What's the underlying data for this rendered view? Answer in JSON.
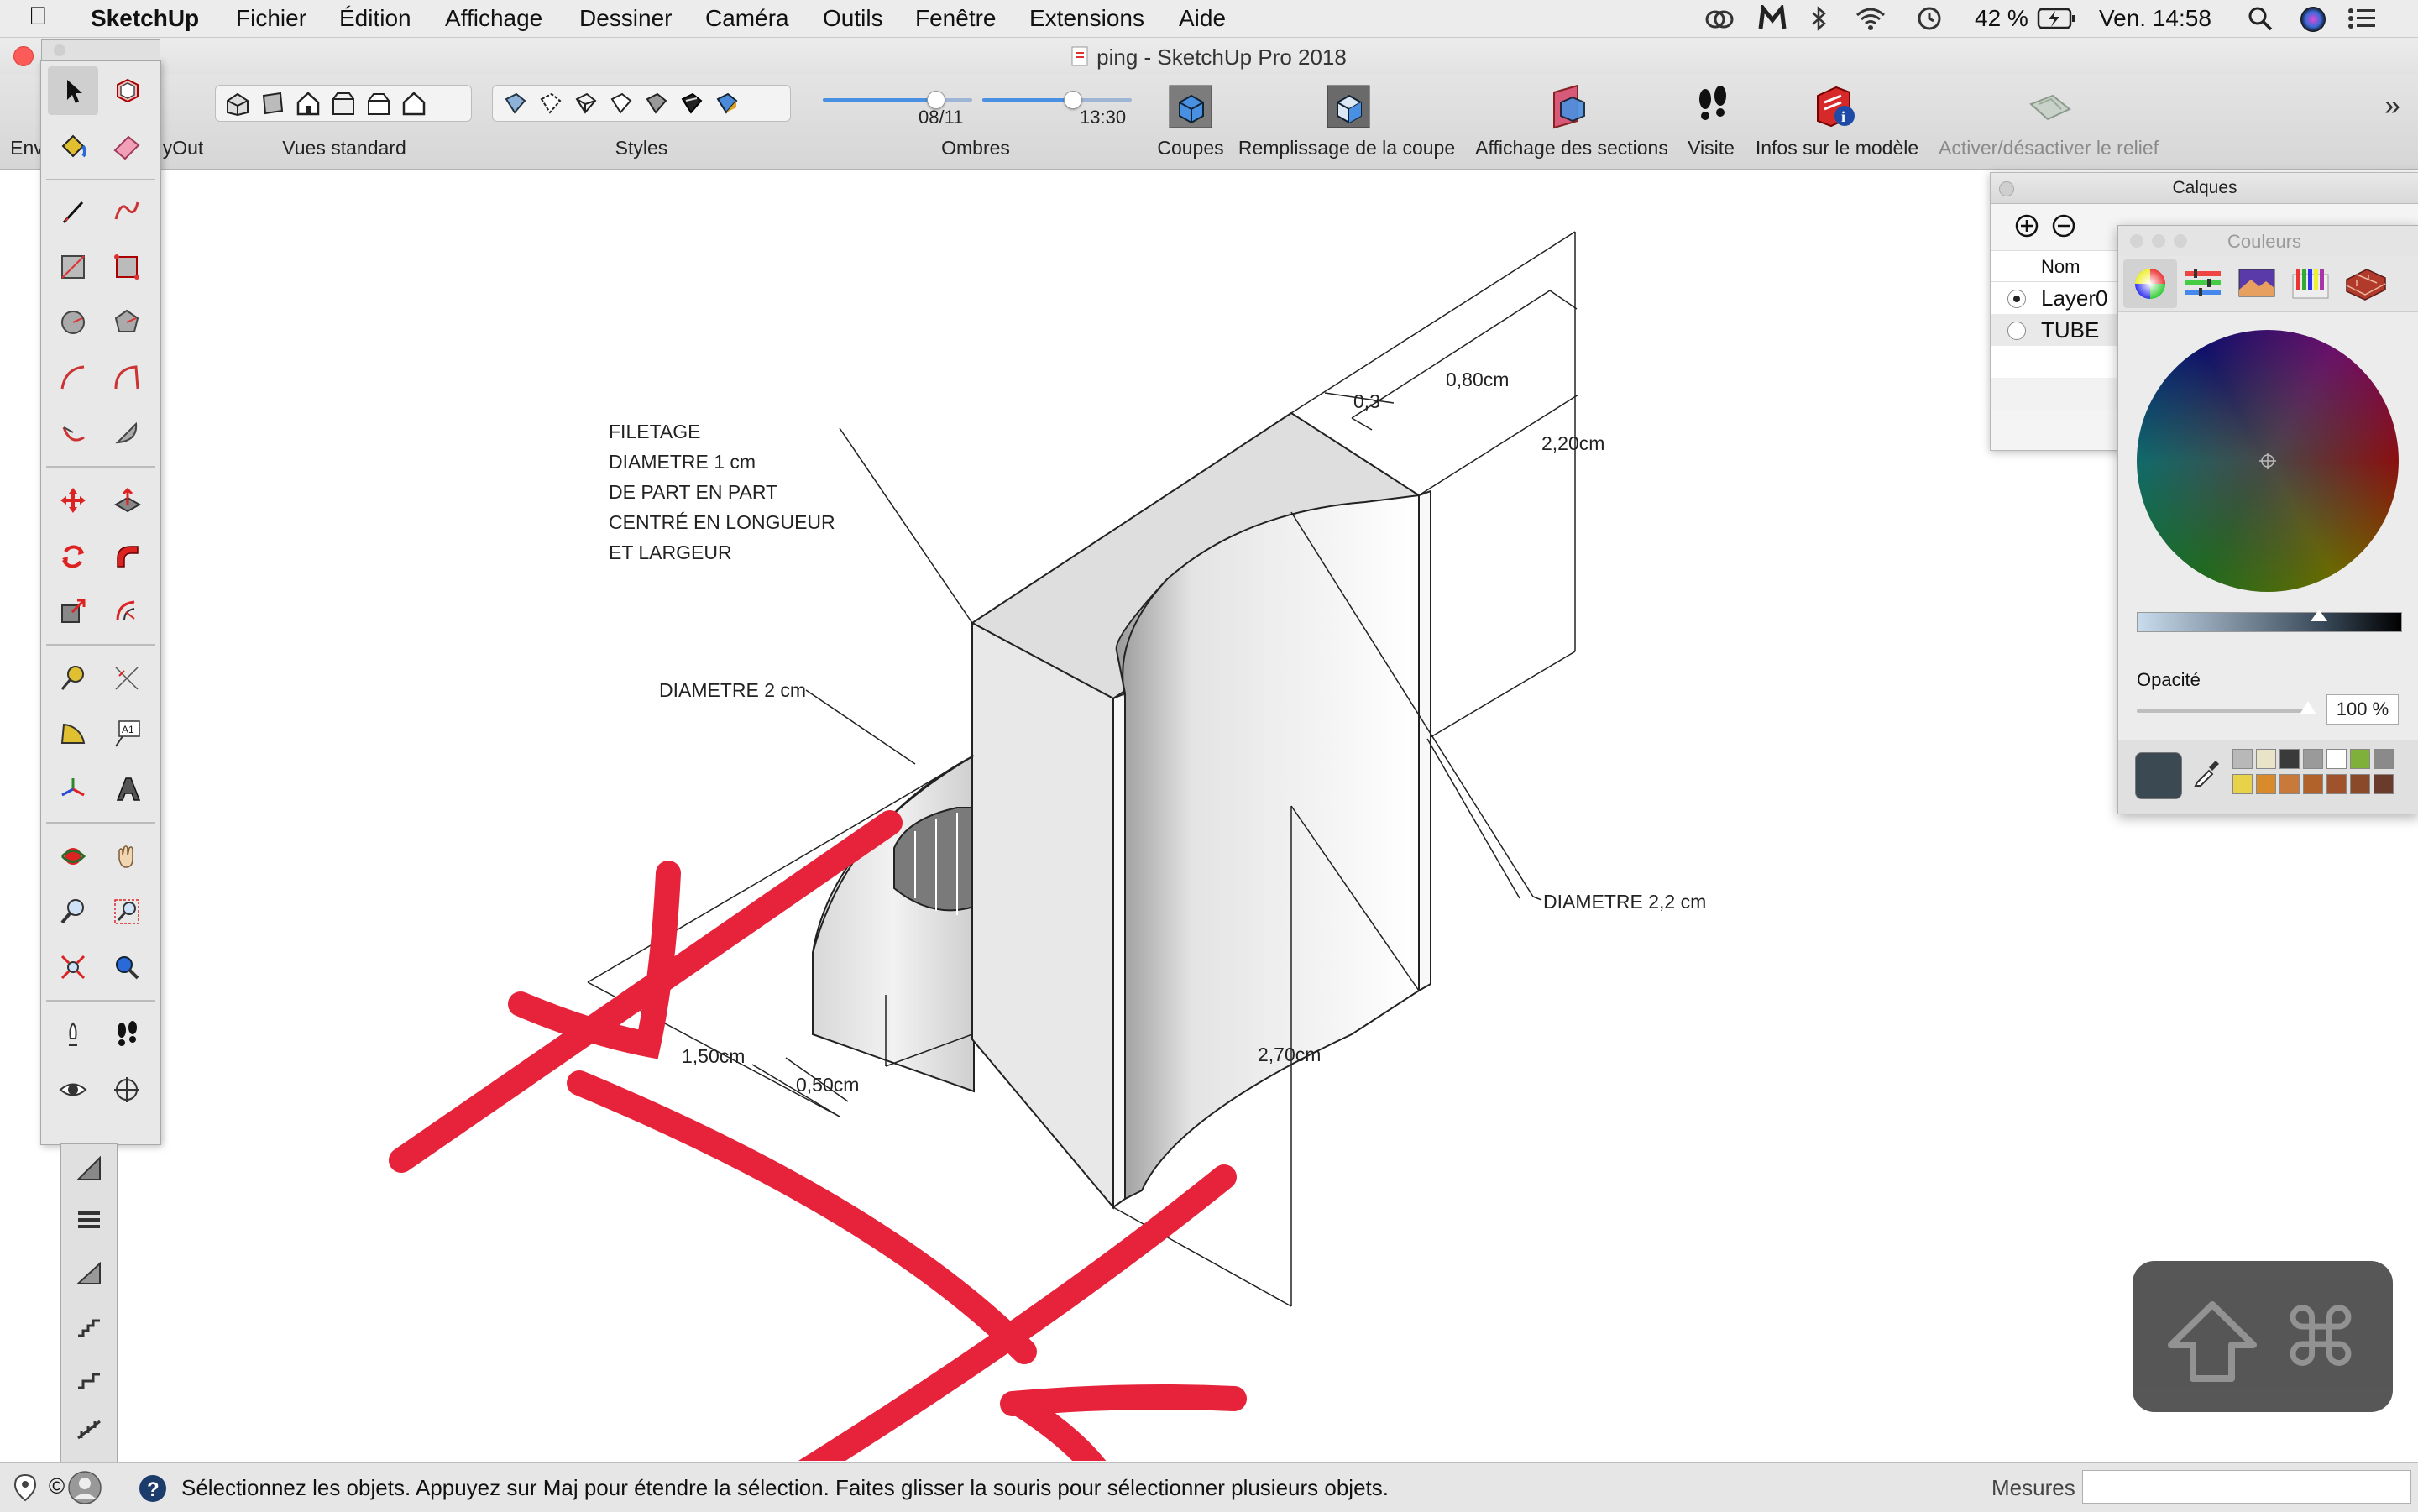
{
  "menubar": {
    "app_name": "SketchUp",
    "menus": [
      "Fichier",
      "Édition",
      "Affichage",
      "Dessiner",
      "Caméra",
      "Outils",
      "Fenêtre",
      "Extensions",
      "Aide"
    ],
    "battery": "42 %",
    "clock": "Ven. 14:58"
  },
  "window": {
    "title": "ping - SketchUp Pro 2018"
  },
  "toolbar": {
    "clipped_left": "Env",
    "clipped_layout": "yOut",
    "groups": {
      "standard_views": "Vues standard",
      "styles": "Styles",
      "shadows": "Ombres"
    },
    "shadow_date": "08/11",
    "shadow_time": "13:30",
    "shadow_date_position": 0.75,
    "shadow_time_position": 0.6,
    "buttons": {
      "sections": "Coupes",
      "section_fill": "Remplissage de la coupe",
      "section_display": "Affichage des sections",
      "walk": "Visite",
      "model_info": "Infos sur le modèle",
      "terrain_toggle": "Activer/désactiver le relief"
    },
    "overflow": "»"
  },
  "drawing": {
    "annotations": {
      "thread_note": [
        "FILETAGE",
        "DIAMETRE 1 cm",
        "DE PART EN PART",
        "CENTRÉ EN LONGUEUR",
        "ET LARGEUR"
      ],
      "diameter_2": "DIAMETRE 2 cm",
      "diameter_22": "DIAMETRE 2,2 cm"
    },
    "dimensions": {
      "d080": "0,80cm",
      "d03": "0,3",
      "d220": "2,20cm",
      "d270": "2,70cm",
      "d150": "1,50cm",
      "d050": "0,50cm"
    }
  },
  "calques": {
    "title": "Calques",
    "column_name": "Nom",
    "layers": [
      {
        "name": "Layer0",
        "active": true
      },
      {
        "name": "TUBE",
        "active": false
      }
    ]
  },
  "couleurs": {
    "title": "Couleurs",
    "opacity_label": "Opacité",
    "opacity_value": "100 %",
    "current_color": "#3b4a52",
    "swatches": [
      "#b8b8b8",
      "#e9e4c8",
      "#3a3a3a",
      "#9a9a9a",
      "#ffffff",
      "#7fb03a",
      "#8a8a8a",
      "#e8d24a",
      "#d98a2a",
      "#c97a3a",
      "#b0622a",
      "#a0522a",
      "#8a4a2a",
      "#6a3a2a"
    ]
  },
  "statusbar": {
    "hint": "Sélectionnez les objets. Appuyez sur Maj pour étendre la sélection. Faites glisser la souris pour sélectionner plusieurs objets.",
    "measurements_label": "Mesures"
  },
  "colors": {
    "accent_red": "#e6233a",
    "highlight_blue": "#4a90e2"
  }
}
